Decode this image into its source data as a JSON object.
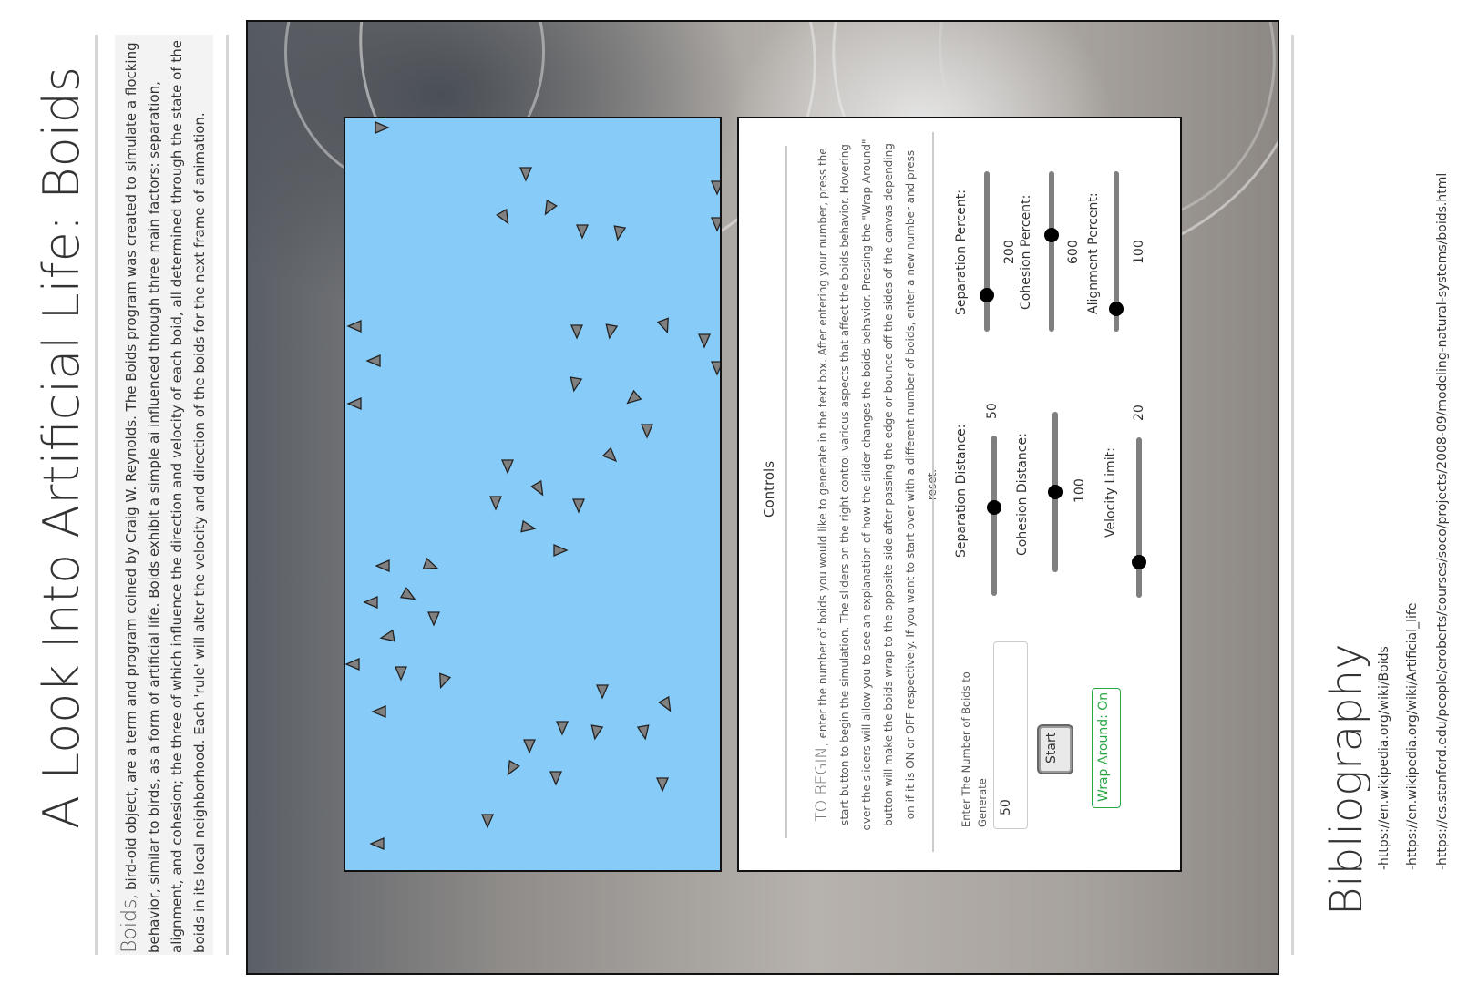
{
  "page": {
    "title": "A Look Into Artificial Life: Boids",
    "intro_lead": "Boids",
    "intro_text": ", bird-oid object, are a term and program coined by Craig W. Reynolds. The Boids program was created to simulate a flocking behavior, similar to birds, as a form of artificial life. Boids exhibit a simple ai influenced through three main factors: separation, alignment, and cohesion; the three of which influence the direction and velocity of each boid, all determined through the state of the boids in its local neighborhood. Each 'rule' will alter the velocity and direction of the boids for the next frame of animation."
  },
  "controls": {
    "title": "Controls",
    "instructions_lead": "TO BEGIN,",
    "instructions_text": " enter the number of boids you would like to generate in the text box. After entering your number, press the start button to begin the simulation. The sliders on the right control various aspects that affect the boids behavior. Hovering over the sliders will allow you to see an explanation of how the slider changes the boids behavior. Pressing the \"Wrap Around\" button will make the boids wrap to the opposite side after passing the edge or bounce off the sides of the canvas depending on if it is ON or OFF respectively. If you want to start over with a different number of boids, enter a new number and press reset.",
    "count_label": "Enter The Number of Boids to Generate",
    "count_value": "50",
    "start_label": "Start",
    "wrap_label": "Wrap Around: On",
    "sliders": [
      {
        "label": "Separation Distance:",
        "value": "50",
        "fraction": 0.55
      },
      {
        "label": "Cohesion Distance:",
        "value": "100",
        "fraction": 0.5
      },
      {
        "label": "Velocity Limit:",
        "value": "20",
        "fraction": 0.22
      },
      {
        "label": "Separation Percent:",
        "value": "200",
        "fraction": 0.23
      },
      {
        "label": "Cohesion Percent:",
        "value": "600",
        "fraction": 0.6
      },
      {
        "label": "Alignment Percent:",
        "value": "100",
        "fraction": 0.14
      }
    ]
  },
  "bibliography": {
    "title": "Bibliography",
    "links": [
      "-https://en.wikipedia.org/wiki/Boids",
      "-https://en.wikipedia.org/wiki/Artificial_life",
      "-https://cs.stanford.edu/people/eroberts/courses/soco/projects/2008-09/modeling-natural-systems/boids.html"
    ]
  },
  "colors": {
    "canvas": "#87ccf9",
    "boid_fill": "#808080",
    "wrap_green": "#28a745"
  }
}
